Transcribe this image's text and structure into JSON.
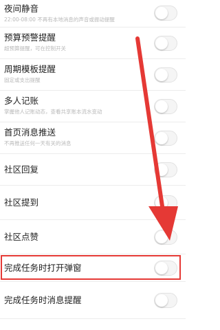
{
  "settings": [
    {
      "title": "夜间静音",
      "subtitle": "22:00-08:00 不再有本地消息的声音或振动提醒",
      "enabled": false
    },
    {
      "title": "预算预警提醒",
      "subtitle": "超预算提醒，可在控制开关",
      "enabled": false
    },
    {
      "title": "周期模板提醒",
      "subtitle": "固定或支出提醒",
      "enabled": false
    },
    {
      "title": "多人记账",
      "subtitle": "掌握他人记账动态，查看共享账本流水变动",
      "enabled": false
    },
    {
      "title": "首页消息推送",
      "subtitle": "不再推送任何一天有关的消息",
      "enabled": false
    },
    {
      "title": "社区回复",
      "subtitle": "",
      "enabled": false
    },
    {
      "title": "社区提到",
      "subtitle": "",
      "enabled": false
    },
    {
      "title": "社区点赞",
      "subtitle": "",
      "enabled": false
    },
    {
      "title": "完成任务时打开弹窗",
      "subtitle": "",
      "enabled": false
    },
    {
      "title": "完成任务时消息提醒",
      "subtitle": "",
      "enabled": false
    }
  ],
  "colors": {
    "highlight": "#e53935",
    "arrow": "#e53935",
    "toggle_off": "#f5f5f5"
  }
}
